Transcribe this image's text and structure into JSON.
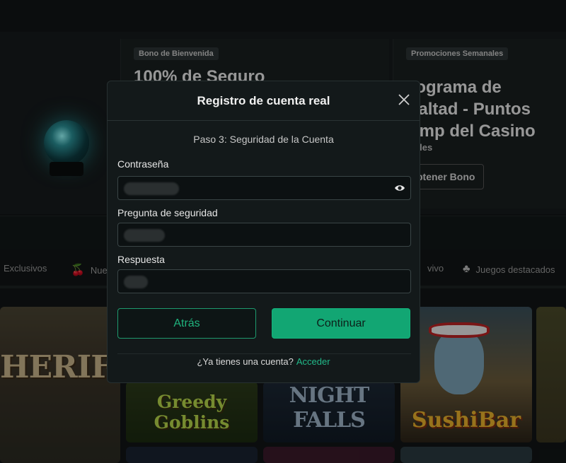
{
  "background": {
    "promo_1": {
      "badge": "Bono de Bienvenida",
      "title": "100% de Seguro"
    },
    "promo_2": {
      "badge": "Promociones Semanales",
      "title_lines": [
        "rograma de",
        "ealtad - Puntos",
        "omp del Casino"
      ],
      "sub": "talles",
      "button": "btener Bono"
    },
    "categories": [
      {
        "label": "Exclusivos",
        "icon": ""
      },
      {
        "label": "Nue",
        "icon": "cherry-icon"
      },
      {
        "label": "vivo",
        "icon": ""
      },
      {
        "label": "Juegos destacados",
        "icon": "clover-icon"
      }
    ],
    "games": {
      "sheriff": "HERIFF",
      "greedy": "Greedy Goblins",
      "after": "AFTER NIGHT FALLS",
      "sushi": "SushiBar"
    }
  },
  "modal": {
    "title": "Registro de cuenta real",
    "step": "Paso 3: Seguridad de la Cuenta",
    "fields": {
      "password_label": "Contraseña",
      "question_label": "Pregunta de seguridad",
      "answer_label": "Respuesta"
    },
    "back_label": "Atrás",
    "continue_label": "Continuar",
    "footer_text": "¿Ya tienes una cuenta?",
    "login_link": "Acceder"
  },
  "colors": {
    "accent": "#12a673",
    "link": "#21b989",
    "modal_bg": "#13191a"
  }
}
